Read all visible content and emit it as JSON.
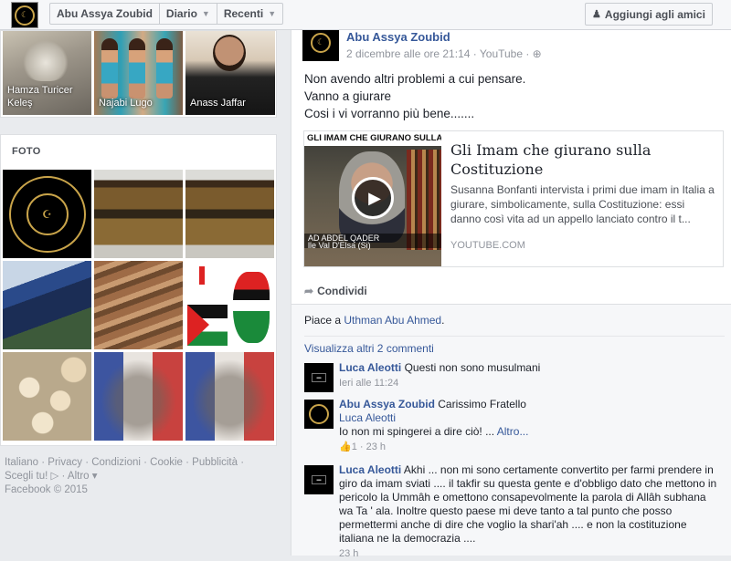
{
  "topbar": {
    "name_button": "Abu Assya Zoubid",
    "timeline_button": "Diario",
    "recent_button": "Recenti",
    "add_friend_button": "Aggiungi agli amici"
  },
  "friends": [
    {
      "name": "Hamza Turicer Keleş"
    },
    {
      "name": "Najabi Lugo"
    },
    {
      "name": "Anass Jaffar"
    }
  ],
  "photos": {
    "title": "FOTO",
    "emblem_text": "ISLAM IS THE ONLY WAY OF LIFE"
  },
  "footer": {
    "line1": "Italiano · Privacy · Condizioni · Cookie · Pubblicità ·",
    "line2": "Scegli tu! ▷ · Altro ▾",
    "line3": "Facebook © 2015"
  },
  "post": {
    "author": "Abu Assya Zoubid",
    "meta": "2 dicembre alle ore 21:14 · YouTube · ⊕",
    "text": [
      "Non avendo altri problemi a cui pensare.",
      "Vanno a giurare",
      "Cosi i vi vorranno più bene......."
    ],
    "link": {
      "thumb_caption": "GLI IMAM CHE GIURANO SULLA COSTITU",
      "thumb_lower": "AD ABDEL QADER",
      "thumb_lower2": "lle Val D'Elsa (Si)",
      "title": "Gli Imam che giurano sulla Costituzione",
      "description": "Susanna Bonfanti intervista i primi due imam in Italia a giurare, simbolicamente, sulla Costituzione: essi danno così vita ad un appello lanciato contro il t...",
      "source": "YOUTUBE.COM"
    },
    "share_label": "Condividi",
    "likes_prefix": "Piace a ",
    "likes_name": "Uthman Abu Ahmed",
    "likes_suffix": ".",
    "more_comments": "Visualizza altri 2 commenti"
  },
  "comments": [
    {
      "name": "Luca Aleotti",
      "text": "Questi non sono musulmani",
      "meta": "Ieri alle 11:24"
    },
    {
      "name": "Abu Assya Zoubid",
      "text": "Carissimo Fratello",
      "mention": "Luca Aleotti",
      "text2": "Io non mi spingerei a dire ciò! ...",
      "more": "Altro...",
      "likes": "1",
      "meta": "· 23 h"
    },
    {
      "name": "Luca Aleotti",
      "text": "Akhi ... non mi sono certamente convertito per farmi prendere in giro da imam sviati .... il takfir su questa gente e d'obbligo dato che mettono in pericolo la Ummâh e omettono consapevolmente la parola di Allâh subhana wa Ta ' ala. Inoltre questo paese mi deve tanto a tal punto che posso permettermi anche di dire che voglio la shari'ah .... e non la costituzione italiana ne la democrazia ....",
      "meta": "23 h"
    }
  ]
}
